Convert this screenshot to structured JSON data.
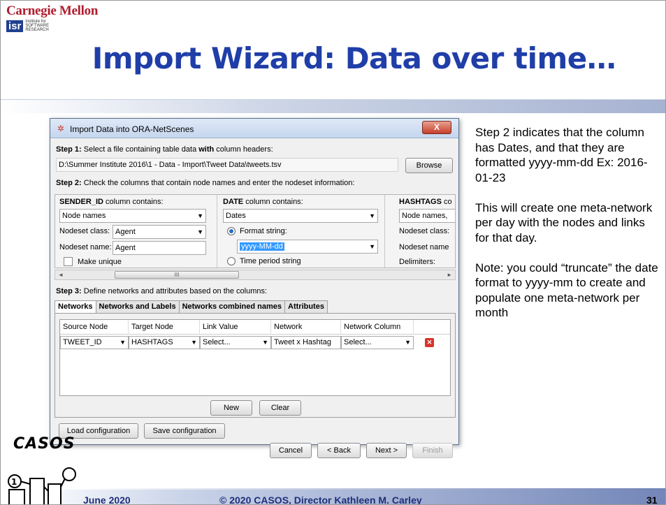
{
  "header": {
    "university": "Carnegie Mellon",
    "institute_badge": "isr",
    "institute_lines": [
      "institute for",
      "SOFTWARE",
      "RESEARCH"
    ],
    "slide_title": "Import Wizard: Data over time…"
  },
  "dialog": {
    "title": "Import Data into ORA-NetScenes",
    "close_label": "X",
    "step1": {
      "label_bold": "Step 1:",
      "label_text": " Select a file containing table data ",
      "label_bold2": "with",
      "label_text2": " column headers:",
      "file_path": "D:\\Summer Institute 2016\\1 - Data - Import\\Tweet Data\\tweets.tsv",
      "browse_label": "Browse"
    },
    "step2": {
      "label_bold": "Step 2:",
      "label_text": " Check the columns that contain node names and enter the nodeset information:",
      "columns": [
        {
          "header_bold": "SENDER_ID",
          "header_text": " column contains:",
          "contains_value": "Node names",
          "nodeset_class_label": "Nodeset class:",
          "nodeset_class_value": "Agent",
          "nodeset_name_label": "Nodeset name:",
          "nodeset_name_value": "Agent",
          "make_unique_label": "Make unique"
        },
        {
          "header_bold": "DATE",
          "header_text": " column contains:",
          "contains_value": "Dates",
          "format_string_label": "Format string:",
          "format_string_value": "yyyy-MM-dd",
          "time_period_label": "Time period string"
        },
        {
          "header_bold": "HASHTAGS",
          "header_text": " co",
          "contains_value": "Node names,",
          "nodeset_class_label": "Nodeset class:",
          "nodeset_name_label": "Nodeset name",
          "delimiters_label": "Delimiters:"
        }
      ],
      "scroll_thumb": "III"
    },
    "step3": {
      "label_bold": "Step 3:",
      "label_text": " Define networks and attributes based on the columns:",
      "tabs": [
        "Networks",
        "Networks and Labels",
        "Networks combined names",
        "Attributes"
      ],
      "grid_headers": [
        "Source Node",
        "Target Node",
        "Link Value",
        "Network",
        "Network Column"
      ],
      "grid_row": [
        "TWEET_ID",
        "HASHTAGS",
        "Select...",
        "Tweet x Hashtag",
        "Select..."
      ],
      "new_label": "New",
      "clear_label": "Clear"
    },
    "load_config_label": "Load configuration",
    "save_config_label": "Save configuration",
    "cancel_label": "Cancel",
    "back_label": "< Back",
    "next_label": "Next >",
    "finish_label": "Finish"
  },
  "notes": [
    "Step 2 indicates that the column has Dates, and that they are formatted yyyy-mm-dd Ex: 2016-01-23",
    "This will create one meta-network per day with the nodes and links for that day.",
    "Note: you could “truncate” the date format to yyyy-mm to create and populate one meta-network per month"
  ],
  "footer": {
    "logo_text": "CASOS",
    "date": "June 2020",
    "copyright": "© 2020 CASOS, Director Kathleen M. Carley",
    "page_number": "31"
  },
  "colors": {
    "title_blue": "#1f3ea8",
    "cmu_red": "#b01c2e",
    "footer_text": "#1f2f7a"
  }
}
